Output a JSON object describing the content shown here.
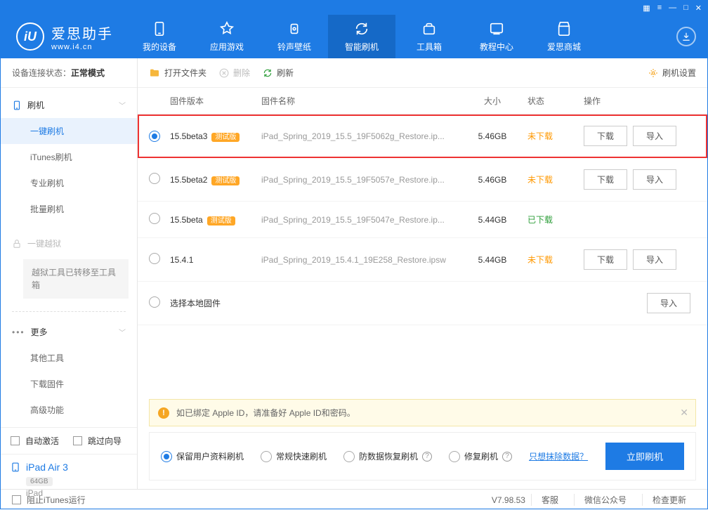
{
  "titlebar": {
    "icons": [
      "grid",
      "list",
      "min",
      "max",
      "close"
    ]
  },
  "logo": {
    "mark": "iU",
    "cn": "爱思助手",
    "en": "www.i4.cn"
  },
  "nav": [
    {
      "id": "device",
      "label": "我的设备"
    },
    {
      "id": "apps",
      "label": "应用游戏"
    },
    {
      "id": "ringtone",
      "label": "铃声壁纸"
    },
    {
      "id": "flash",
      "label": "智能刷机",
      "active": true
    },
    {
      "id": "tools",
      "label": "工具箱"
    },
    {
      "id": "tutorial",
      "label": "教程中心"
    },
    {
      "id": "store",
      "label": "爱思商城"
    }
  ],
  "sidebar": {
    "conn_label": "设备连接状态：",
    "conn_value": "正常模式",
    "groups": {
      "flash": {
        "label": "刷机",
        "items": [
          {
            "id": "oneclick",
            "label": "一键刷机",
            "active": true
          },
          {
            "id": "itunes",
            "label": "iTunes刷机"
          },
          {
            "id": "pro",
            "label": "专业刷机"
          },
          {
            "id": "batch",
            "label": "批量刷机"
          }
        ]
      },
      "jailbreak": {
        "label": "一键越狱",
        "disabled": true,
        "notice": "越狱工具已转移至工具箱"
      },
      "more": {
        "label": "更多",
        "items": [
          {
            "id": "other",
            "label": "其他工具"
          },
          {
            "id": "download",
            "label": "下载固件"
          },
          {
            "id": "adv",
            "label": "高级功能"
          }
        ]
      }
    },
    "auto_activate": "自动激活",
    "skip_guide": "跳过向导",
    "device": {
      "name": "iPad Air 3",
      "storage": "64GB",
      "type": "iPad"
    }
  },
  "toolbar": {
    "open": "打开文件夹",
    "delete": "删除",
    "refresh": "刷新",
    "settings": "刷机设置"
  },
  "table": {
    "headers": {
      "version": "固件版本",
      "name": "固件名称",
      "size": "大小",
      "status": "状态",
      "ops": "操作"
    },
    "beta_tag": "测试版",
    "btn_download": "下载",
    "btn_import": "导入",
    "select_local": "选择本地固件",
    "rows": [
      {
        "selected": true,
        "highlight": true,
        "version": "15.5beta3",
        "beta": true,
        "name": "iPad_Spring_2019_15.5_19F5062g_Restore.ip...",
        "size": "5.46GB",
        "status": "未下载",
        "status_cls": "nd",
        "download": true,
        "import": true
      },
      {
        "version": "15.5beta2",
        "beta": true,
        "name": "iPad_Spring_2019_15.5_19F5057e_Restore.ip...",
        "size": "5.46GB",
        "status": "未下载",
        "status_cls": "nd",
        "download": true,
        "import": true
      },
      {
        "version": "15.5beta",
        "beta": true,
        "name": "iPad_Spring_2019_15.5_19F5047e_Restore.ip...",
        "size": "5.44GB",
        "status": "已下载",
        "status_cls": "dl",
        "download": false,
        "import": false
      },
      {
        "version": "15.4.1",
        "beta": false,
        "name": "iPad_Spring_2019_15.4.1_19E258_Restore.ipsw",
        "size": "5.44GB",
        "status": "未下载",
        "status_cls": "nd",
        "download": true,
        "import": true
      }
    ]
  },
  "alert": "如已绑定 Apple ID，请准备好 Apple ID和密码。",
  "flash_options": {
    "keep_data": "保留用户资料刷机",
    "normal": "常规快速刷机",
    "anti_loss": "防数据恢复刷机",
    "repair": "修复刷机",
    "erase_link": "只想抹除数据？",
    "start": "立即刷机"
  },
  "footer": {
    "block_itunes": "阻止iTunes运行",
    "version": "V7.98.53",
    "service": "客服",
    "wechat": "微信公众号",
    "update": "检查更新"
  }
}
